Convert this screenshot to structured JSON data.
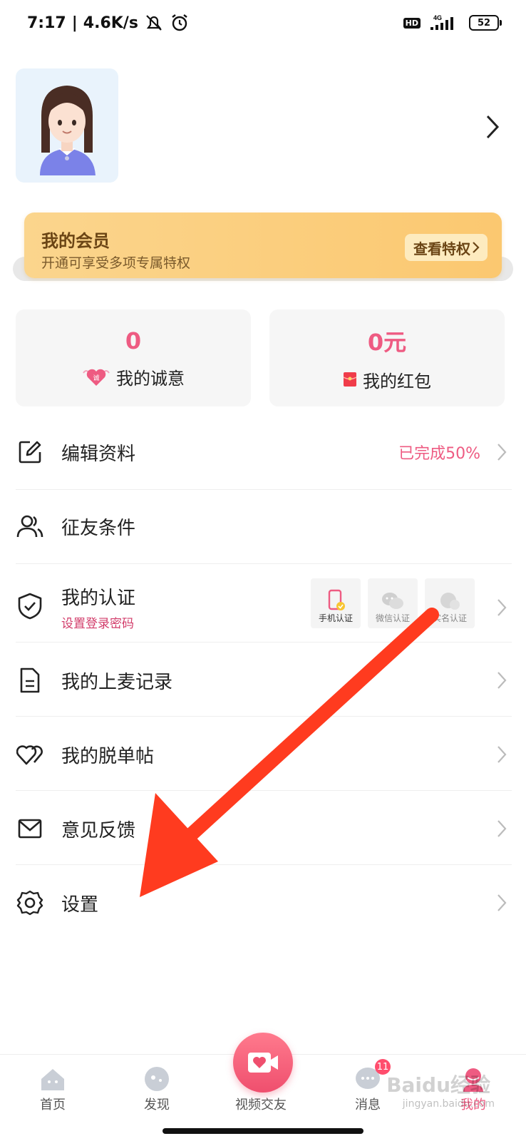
{
  "status": {
    "time": "7:17",
    "speed": "4.6K/s",
    "network": "4G",
    "hd": "HD",
    "battery": "52"
  },
  "vip": {
    "title": "我的会员",
    "subtitle": "开通可享受多项专属特权",
    "button": "查看特权"
  },
  "stats": {
    "sincerity_value": "0",
    "sincerity_label": "我的诚意",
    "sincerity_icon_text": "诚",
    "redpacket_value": "0元",
    "redpacket_label": "我的红包"
  },
  "menu": {
    "edit_profile": "编辑资料",
    "edit_progress": "已完成50%",
    "criteria": "征友条件",
    "verification": "我的认证",
    "verification_sub": "设置登录密码",
    "auth_phone": "手机认证",
    "auth_wechat": "微信认证",
    "auth_realname": "实名认证",
    "mic_records": "我的上麦记录",
    "posts": "我的脱单帖",
    "feedback": "意见反馈",
    "settings": "设置"
  },
  "nav": {
    "home": "首页",
    "discover": "发现",
    "video": "视频交友",
    "messages": "消息",
    "messages_badge": "11",
    "me": "我的"
  },
  "watermark": {
    "brand": "Baidu经验",
    "site": "jingyan.baidu.com"
  },
  "colors": {
    "accent": "#ee5b82",
    "vip_gold": "#fbc870",
    "arrow_red": "#ff3b1f"
  }
}
